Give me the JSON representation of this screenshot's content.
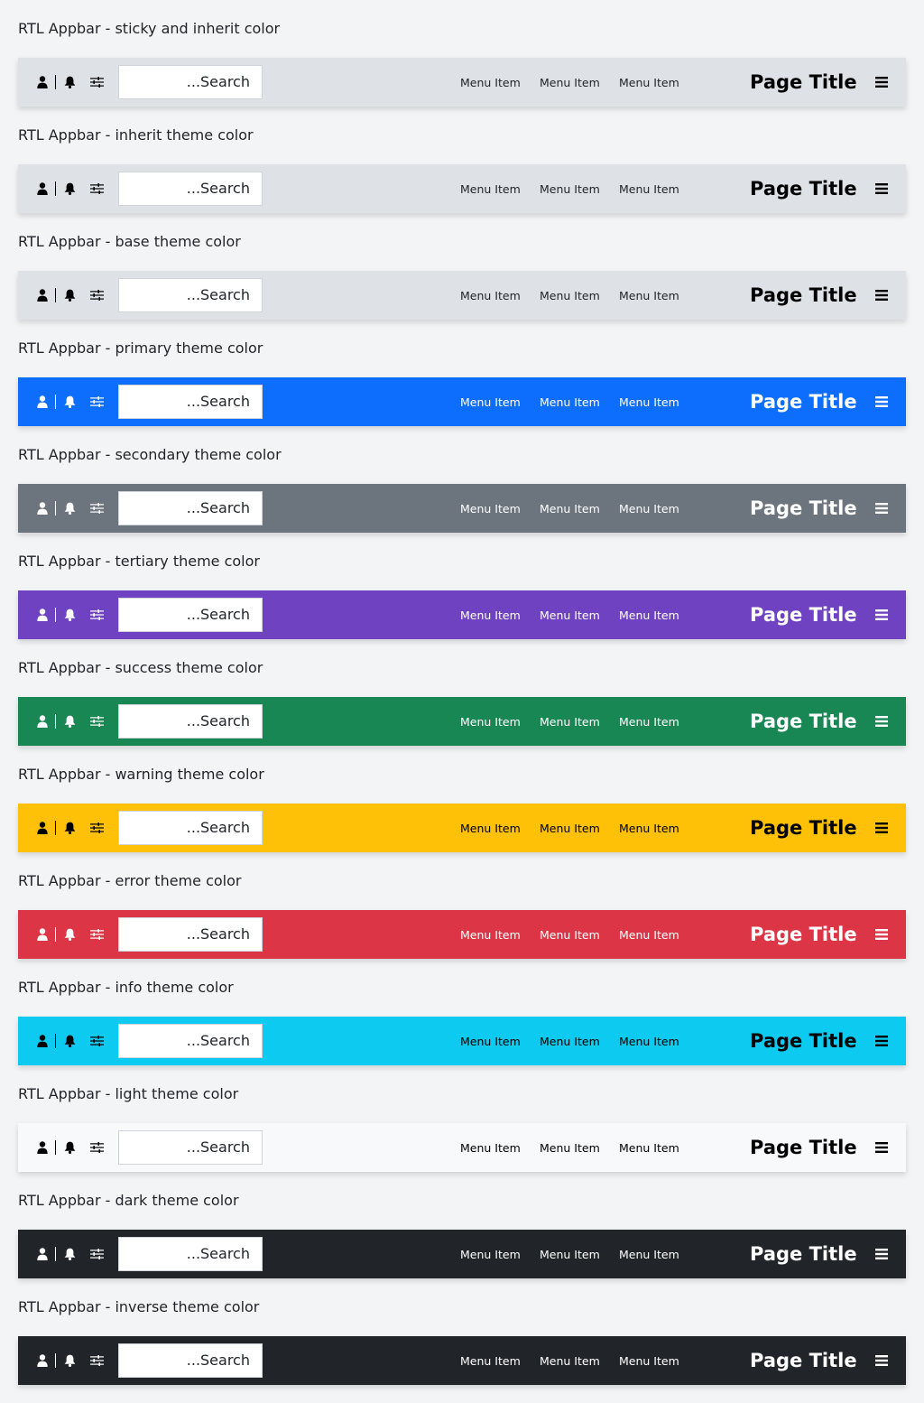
{
  "common": {
    "search_placeholder": "...Search",
    "menu_items": [
      "Menu Item",
      "Menu Item",
      "Menu Item"
    ],
    "page_title": "Page Title",
    "icons": [
      "user-icon",
      "bell-icon",
      "settings-icon",
      "hamburger-icon"
    ]
  },
  "appbars": [
    {
      "label": "RTL Appbar - sticky and inherit color",
      "bg": "#dee2e6",
      "fg": "#000000",
      "muted": "#212529"
    },
    {
      "label": "RTL Appbar - inherit theme color",
      "bg": "#dee2e6",
      "fg": "#000000",
      "muted": "#212529"
    },
    {
      "label": "RTL Appbar - base theme color",
      "bg": "#dee2e6",
      "fg": "#000000",
      "muted": "#212529"
    },
    {
      "label": "RTL Appbar - primary theme color",
      "bg": "#0d6efd",
      "fg": "#ffffff",
      "muted": "#ffffff"
    },
    {
      "label": "RTL Appbar - secondary theme color",
      "bg": "#6c757d",
      "fg": "#ffffff",
      "muted": "#ffffff"
    },
    {
      "label": "RTL Appbar - tertiary theme color",
      "bg": "#6f42c1",
      "fg": "#ffffff",
      "muted": "#ffffff"
    },
    {
      "label": "RTL Appbar - success theme color",
      "bg": "#198754",
      "fg": "#ffffff",
      "muted": "#ffffff"
    },
    {
      "label": "RTL Appbar - warning theme color",
      "bg": "#ffc107",
      "fg": "#000000",
      "muted": "#000000"
    },
    {
      "label": "RTL Appbar - error theme color",
      "bg": "#dc3545",
      "fg": "#ffffff",
      "muted": "#ffffff"
    },
    {
      "label": "RTL Appbar - info theme color",
      "bg": "#0dcaf0",
      "fg": "#000000",
      "muted": "#000000"
    },
    {
      "label": "RTL Appbar - light theme color",
      "bg": "#f8f9fa",
      "fg": "#000000",
      "muted": "#000000"
    },
    {
      "label": "RTL Appbar - dark theme color",
      "bg": "#212529",
      "fg": "#ffffff",
      "muted": "#ffffff"
    },
    {
      "label": "RTL Appbar - inverse theme color",
      "bg": "#212529",
      "fg": "#ffffff",
      "muted": "#ffffff"
    }
  ]
}
